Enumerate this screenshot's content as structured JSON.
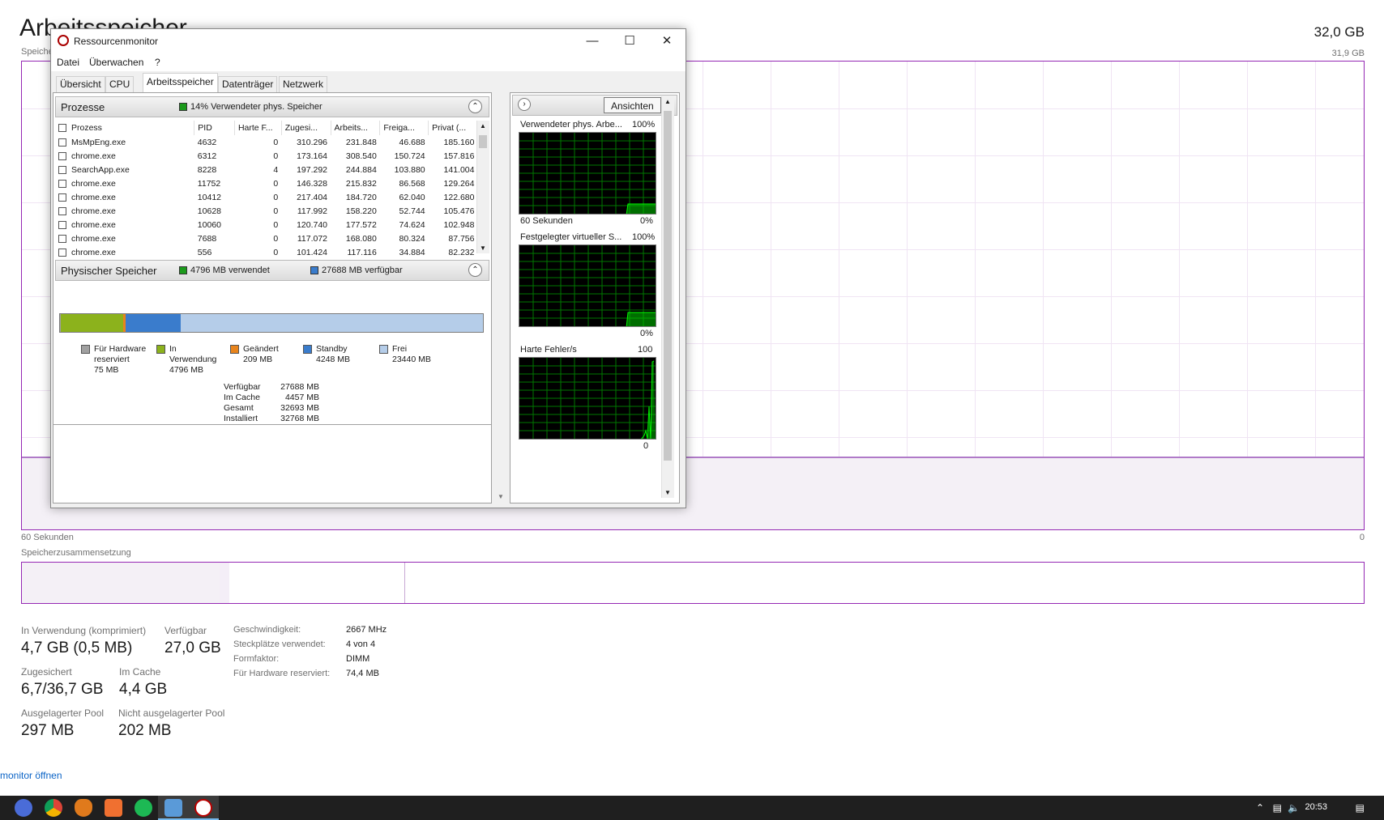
{
  "taskmanager": {
    "title": "Arbeitsspeicher",
    "total": "32,0 GB",
    "graph_label": "Speicher",
    "graph_max": "31,9 GB",
    "x_left": "60 Sekunden",
    "x_right": "0",
    "composition_label": "Speicherzusammensetzung",
    "stats": [
      {
        "label": "In Verwendung (komprimiert)",
        "value": "4,7 GB (0,5 MB)"
      },
      {
        "label": "Verfügbar",
        "value": "27,0 GB"
      },
      {
        "label": "Zugesichert",
        "value": "6,7/36,7 GB"
      },
      {
        "label": "Im Cache",
        "value": "4,4 GB"
      },
      {
        "label": "Ausgelagerter Pool",
        "value": "297 MB"
      },
      {
        "label": "Nicht ausgelagerter Pool",
        "value": "202 MB"
      }
    ],
    "details": [
      {
        "label": "Geschwindigkeit:",
        "value": "2667 MHz"
      },
      {
        "label": "Steckplätze verwendet:",
        "value": "4 von 4"
      },
      {
        "label": "Formfaktor:",
        "value": "DIMM"
      },
      {
        "label": "Für Hardware reserviert:",
        "value": "74,4 MB"
      }
    ],
    "open_link": "monitor öffnen"
  },
  "resmon": {
    "title": "Ressourcenmonitor",
    "menu": [
      "Datei",
      "Überwachen",
      "?"
    ],
    "tabs": [
      "Übersicht",
      "CPU",
      "Arbeitsspeicher",
      "Datenträger",
      "Netzwerk"
    ],
    "processes": {
      "title": "Prozesse",
      "summary": "14% Verwendeter phys. Speicher",
      "columns": [
        "Prozess",
        "PID",
        "Harte F...",
        "Zugesi...",
        "Arbeits...",
        "Freiga...",
        "Privat (..."
      ],
      "rows": [
        [
          "MsMpEng.exe",
          "4632",
          "0",
          "310.296",
          "231.848",
          "46.688",
          "185.160"
        ],
        [
          "chrome.exe",
          "6312",
          "0",
          "173.164",
          "308.540",
          "150.724",
          "157.816"
        ],
        [
          "SearchApp.exe",
          "8228",
          "4",
          "197.292",
          "244.884",
          "103.880",
          "141.004"
        ],
        [
          "chrome.exe",
          "11752",
          "0",
          "146.328",
          "215.832",
          "86.568",
          "129.264"
        ],
        [
          "chrome.exe",
          "10412",
          "0",
          "217.404",
          "184.720",
          "62.040",
          "122.680"
        ],
        [
          "chrome.exe",
          "10628",
          "0",
          "117.992",
          "158.220",
          "52.744",
          "105.476"
        ],
        [
          "chrome.exe",
          "10060",
          "0",
          "120.740",
          "177.572",
          "74.624",
          "102.948"
        ],
        [
          "chrome.exe",
          "7688",
          "0",
          "117.072",
          "168.080",
          "80.324",
          "87.756"
        ],
        [
          "chrome.exe",
          "556",
          "0",
          "101.424",
          "117.116",
          "34.884",
          "82.232"
        ]
      ]
    },
    "physical": {
      "title": "Physischer Speicher",
      "used": "4796 MB verwendet",
      "available": "27688 MB verfügbar",
      "bar_fractions": {
        "reserved": 0.0023,
        "in_use": 0.1464,
        "modified": 0.0064,
        "standby": 0.1296,
        "free": 0.7153
      },
      "legend": [
        {
          "name": "Für Hardware reserviert",
          "lines": [
            "Für Hardware",
            "reserviert",
            "75 MB"
          ],
          "color": "#a0a0a0"
        },
        {
          "name": "In Verwendung",
          "lines": [
            "In",
            "Verwendung",
            "4796 MB"
          ],
          "color": "#8cb21c"
        },
        {
          "name": "Geändert",
          "lines": [
            "Geändert",
            "209 MB"
          ],
          "color": "#e8841c"
        },
        {
          "name": "Standby",
          "lines": [
            "Standby",
            "4248 MB"
          ],
          "color": "#3a7ccc"
        },
        {
          "name": "Frei",
          "lines": [
            "Frei",
            "23440 MB"
          ],
          "color": "#b5cde9"
        }
      ],
      "summary": [
        {
          "label": "Verfügbar",
          "value": "27688 MB"
        },
        {
          "label": "Im Cache",
          "value": "4457 MB"
        },
        {
          "label": "Gesamt",
          "value": "32693 MB"
        },
        {
          "label": "Installiert",
          "value": "32768 MB"
        }
      ]
    },
    "right": {
      "views_button": "Ansichten",
      "graphs": [
        {
          "title": "Verwendeter phys. Arbe...",
          "max": "100%",
          "left_bottom": "60 Sekunden",
          "right_bottom": "0%"
        },
        {
          "title": "Festgelegter virtueller S...",
          "max": "100%",
          "left_bottom": "",
          "right_bottom": "0%"
        },
        {
          "title": "Harte Fehler/s",
          "max": "100",
          "left_bottom": "",
          "right_bottom": "0"
        }
      ]
    }
  },
  "taskbar": {
    "clock": "20:53"
  },
  "colors": {
    "accent": "#9528b4",
    "graph_green": "#00c800"
  }
}
